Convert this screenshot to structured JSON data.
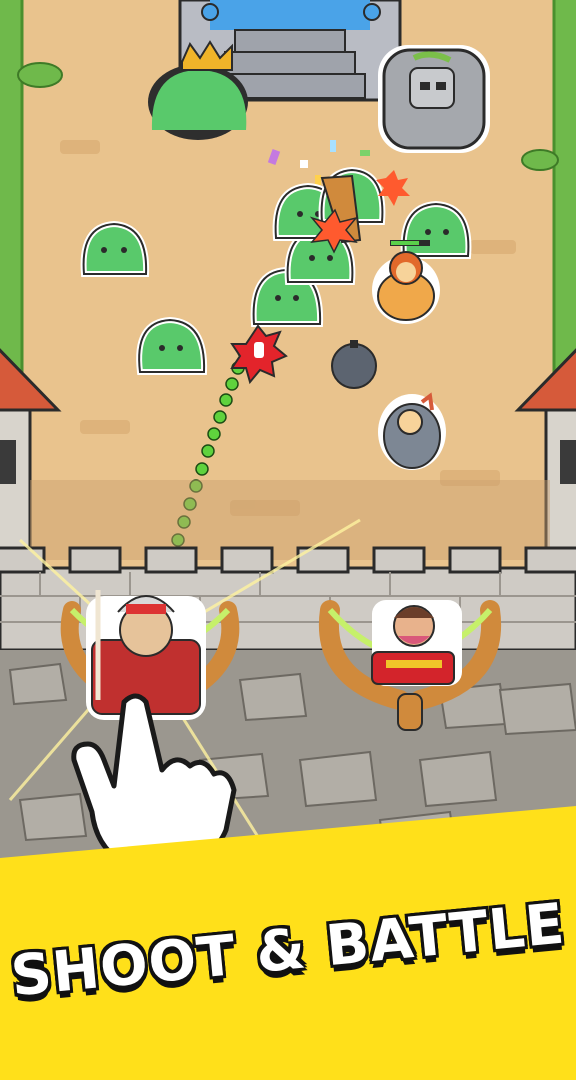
{
  "banner": {
    "title": "SHOOT & BATTLE"
  },
  "colors": {
    "sand": "#e9c38d",
    "grass": "#6fb94b",
    "wall": "#cfcbc5",
    "slime": "#59c96b",
    "banner_yellow": "#ffe01a",
    "roof_red": "#d65a3a"
  },
  "icons": {
    "tap_hand": "pointer-hand-icon",
    "hit_marker": "hand-hit-icon"
  }
}
